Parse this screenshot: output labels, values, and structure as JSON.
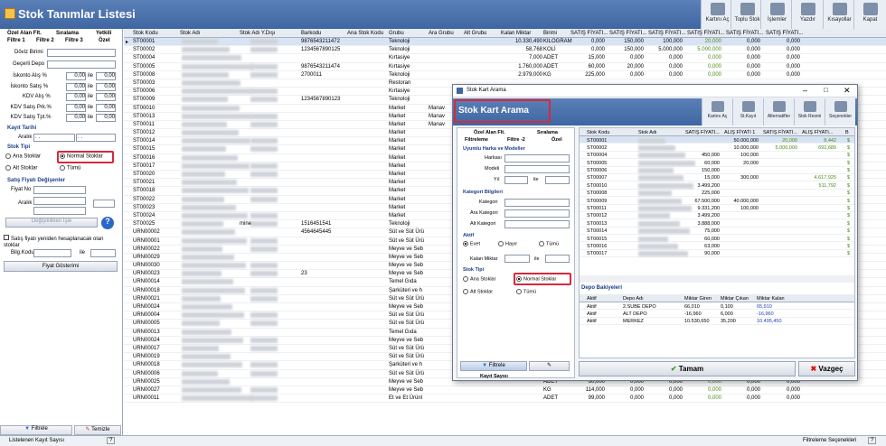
{
  "window": {
    "title": "Stok Tanımlar Listesi"
  },
  "toolbar": [
    {
      "label": "Kartını Aç",
      "icon": "open-card-icon"
    },
    {
      "label": "Toplu Stok",
      "icon": "bulk-stock-icon"
    },
    {
      "label": "İşlemler",
      "icon": "operations-icon"
    },
    {
      "label": "Yazdır",
      "icon": "print-icon"
    },
    {
      "label": "Kısayollar",
      "icon": "shortcuts-icon"
    },
    {
      "label": "Kapat",
      "icon": "close-door-icon"
    }
  ],
  "left": {
    "tabs": [
      "Özel Alan Flt.",
      "Sıralama",
      "Yetkili",
      "Filtre 1",
      "Filtre 2",
      "Filtre 3",
      "Özel"
    ],
    "doviz_label": "Döviz Birimi",
    "depo_label": "Geçerli Depo",
    "discounts": [
      {
        "label": "İskonto Alış %",
        "a": "0,00",
        "ile": "ile",
        "b": "0,00"
      },
      {
        "label": "İskonto Satış %",
        "a": "0,00",
        "ile": "ile",
        "b": "0,00"
      },
      {
        "label": "KDV Alış %",
        "a": "0,00",
        "ile": "ile",
        "b": "0,00"
      },
      {
        "label": "KDV Satış Prk.%",
        "a": "0,00",
        "ile": "ile",
        "b": "0,00"
      },
      {
        "label": "KDV Satış Tpt.%",
        "a": "0,00",
        "ile": "ile",
        "b": "0,00"
      }
    ],
    "kayit_tarihi": "Kayıt Tarihi",
    "aralik": "Aralık",
    "date_a": ". .",
    "date_b": ". .",
    "stok_tipi": "Stok Tipi",
    "ana": "Ana Stoklar",
    "normal": "Normal Stoklar",
    "alt": "Alt Stoklar",
    "tumu": "Tümü",
    "satis_fiyati": "Satış Fiyatı Değişenler",
    "fiyat_no": "Fiyat No",
    "recalc": "Satış fiyatı yeniden hesaplanacak olan stoklar",
    "bilg_kodu": "Bilg.Kodu",
    "ile": "ile",
    "fiyat_goster": "Fiyat Gösterimi",
    "degistir": "Değişiklikleri İşle",
    "filtrele": "Filtrele",
    "temizle": "Temizle"
  },
  "grid": {
    "headers": [
      "Stok Kodu",
      "Stok Adı",
      "Stok Adı Y.Dışı",
      "Barkodu",
      "Ana Stok Kodu",
      "Grubu",
      "Ara Grubu",
      "Alt Grubu",
      "Kalan Miktar",
      "Birimi",
      "SATIŞ FİYATI...",
      "SATIŞ FİYATI...",
      "SATIŞ FİYATI...",
      "SATIŞ FİYATI...",
      "SATIŞ FİYATI...",
      "SATIŞ FİYATI..."
    ],
    "rows": [
      [
        "ST00001",
        "",
        "",
        "9876543211472",
        "",
        "Teknoloji",
        "",
        "",
        "10.330,490",
        "KILOGRAM",
        "0,000",
        "150,000",
        "100,000",
        "20,000",
        "0,000",
        "0,000"
      ],
      [
        "ST00002",
        "",
        "",
        "1234567890125",
        "",
        "Teknoloji",
        "",
        "",
        "58,768",
        "KOLİ",
        "0,000",
        "150,000",
        "5.000,000",
        "5.000,000",
        "0,000",
        "0,000"
      ],
      [
        "ST00004",
        "",
        "",
        "",
        "",
        "Kırtasiye",
        "",
        "",
        "7,000",
        "ADET",
        "15,000",
        "0,000",
        "0,000",
        "0,000",
        "0,000",
        "0,000"
      ],
      [
        "ST00005",
        "",
        "",
        "9876543211474",
        "",
        "Kırtasiye",
        "",
        "",
        "1.760,000",
        "ADET",
        "60,000",
        "20,000",
        "0,000",
        "0,000",
        "0,000",
        "0,000"
      ],
      [
        "ST00008",
        "",
        "",
        "2700011",
        "",
        "Teknoloji",
        "",
        "",
        "2.979,000",
        "KG",
        "225,000",
        "0,000",
        "0,000",
        "0,000",
        "0,000",
        "0,000"
      ],
      [
        "ST00003",
        "",
        "",
        "",
        "",
        "Restoran",
        "",
        "",
        "",
        "",
        "",
        "",
        "",
        "",
        "",
        ""
      ],
      [
        "ST00006",
        "",
        "",
        "",
        "",
        "Kırtasiye",
        "",
        "",
        "",
        "",
        "",
        "",
        "",
        "",
        "",
        ""
      ],
      [
        "ST00009",
        "",
        "",
        "1234567890123",
        "",
        "Teknoloji",
        "",
        "",
        "",
        "",
        "",
        "",
        "",
        "",
        "",
        ""
      ],
      [
        "ST00010",
        "",
        "",
        "",
        "",
        "Market",
        "Manav",
        "",
        "",
        "",
        "",
        "",
        "",
        "",
        "",
        ""
      ],
      [
        "ST00013",
        "",
        "",
        "",
        "",
        "Market",
        "Manav",
        "",
        "",
        "",
        "",
        "",
        "",
        "",
        "",
        ""
      ],
      [
        "ST00011",
        "",
        "",
        "",
        "",
        "Market",
        "Manav",
        "",
        "",
        "",
        "",
        "",
        "",
        "",
        "",
        ""
      ],
      [
        "ST00012",
        "",
        "",
        "",
        "",
        "Market",
        "",
        "",
        "",
        "",
        "",
        "",
        "",
        "",
        "",
        ""
      ],
      [
        "ST00014",
        "",
        "",
        "",
        "",
        "Market",
        "",
        "",
        "",
        "",
        "",
        "",
        "",
        "",
        "",
        ""
      ],
      [
        "ST00015",
        "",
        "",
        "",
        "",
        "Market",
        "",
        "",
        "",
        "",
        "",
        "",
        "",
        "",
        "",
        ""
      ],
      [
        "ST00016",
        "",
        "",
        "",
        "",
        "Market",
        "",
        "",
        "",
        "",
        "",
        "",
        "",
        "",
        "",
        ""
      ],
      [
        "ST00017",
        "",
        "",
        "",
        "",
        "Market",
        "",
        "",
        "",
        "",
        "",
        "",
        "",
        "",
        "",
        ""
      ],
      [
        "ST00020",
        "",
        "",
        "",
        "",
        "Market",
        "",
        "",
        "",
        "",
        "",
        "",
        "",
        "",
        "",
        ""
      ],
      [
        "ST00021",
        "",
        "",
        "",
        "",
        "Market",
        "",
        "",
        "",
        "",
        "",
        "",
        "",
        "",
        "",
        ""
      ],
      [
        "ST00018",
        "",
        "",
        "",
        "",
        "Market",
        "",
        "",
        "",
        "",
        "",
        "",
        "",
        "",
        "",
        ""
      ],
      [
        "ST00022",
        "",
        "",
        "",
        "",
        "Market",
        "",
        "",
        "",
        "",
        "",
        "",
        "",
        "",
        "",
        ""
      ],
      [
        "ST00023",
        "",
        "",
        "",
        "",
        "Market",
        "",
        "",
        "",
        "",
        "",
        "",
        "",
        "",
        "",
        ""
      ],
      [
        "ST00024",
        "",
        "",
        "",
        "",
        "Market",
        "",
        "",
        "",
        "",
        "",
        "",
        "",
        "",
        "",
        ""
      ],
      [
        "ST00025",
        "",
        "mine",
        "1516451541",
        "",
        "Teknoloji",
        "",
        "",
        "",
        "",
        "",
        "",
        "",
        "",
        "",
        ""
      ],
      [
        "URN00002",
        "",
        "",
        "4564645445",
        "",
        "Süt ve Süt Ürü",
        "",
        "",
        "",
        "",
        "",
        "",
        "",
        "",
        "",
        ""
      ],
      [
        "URN00001",
        "",
        "",
        "",
        "",
        "Süt ve Süt Ürü",
        "",
        "",
        "",
        "",
        "",
        "",
        "",
        "",
        "",
        ""
      ],
      [
        "URN00022",
        "",
        "",
        "",
        "",
        "Meyve ve Seb",
        "",
        "",
        "",
        "",
        "",
        "",
        "",
        "",
        "",
        ""
      ],
      [
        "URN00029",
        "",
        "",
        "",
        "",
        "Meyve ve Seb",
        "",
        "",
        "",
        "",
        "",
        "",
        "",
        "",
        "",
        ""
      ],
      [
        "URN00030",
        "",
        "",
        "",
        "",
        "Meyve ve Seb",
        "",
        "",
        "",
        "",
        "",
        "",
        "",
        "",
        "",
        ""
      ],
      [
        "URN00023",
        "",
        "",
        "23",
        "",
        "Meyve ve Seb",
        "",
        "",
        "",
        "",
        "",
        "",
        "",
        "",
        "",
        ""
      ],
      [
        "URN00014",
        "",
        "",
        "",
        "",
        "Temel Gıda",
        "",
        "",
        "",
        "",
        "",
        "",
        "",
        "",
        "",
        ""
      ],
      [
        "URN00018",
        "",
        "",
        "",
        "",
        "Şarküteri ve h",
        "",
        "",
        "",
        "",
        "",
        "",
        "",
        "",
        "",
        ""
      ],
      [
        "URN00021",
        "",
        "",
        "",
        "",
        "Süt ve Süt Ürü",
        "",
        "",
        "",
        "",
        "",
        "",
        "",
        "",
        "",
        ""
      ],
      [
        "URN00024",
        "",
        "",
        "",
        "",
        "Meyve ve Seb",
        "",
        "",
        "",
        "",
        "",
        "",
        "",
        "",
        "",
        ""
      ],
      [
        "URN00004",
        "",
        "",
        "",
        "",
        "Süt ve Süt Ürü",
        "",
        "",
        "",
        "",
        "",
        "",
        "",
        "",
        "",
        ""
      ],
      [
        "URN00005",
        "",
        "",
        "",
        "",
        "Süt ve Süt Ürü",
        "",
        "",
        "",
        "",
        "",
        "",
        "",
        "",
        "",
        ""
      ],
      [
        "URN00013",
        "",
        "",
        "",
        "",
        "Temel Gıda",
        "",
        "",
        "",
        "",
        "",
        "",
        "",
        "",
        "",
        ""
      ],
      [
        "URN00024",
        "",
        "",
        "",
        "",
        "Meyve ve Seb",
        "",
        "",
        "",
        "",
        "",
        "",
        "",
        "",
        "",
        ""
      ],
      [
        "URN00017",
        "",
        "",
        "",
        "",
        "Süt ve Süt Ürü",
        "",
        "",
        "",
        "",
        "",
        "",
        "",
        "",
        "",
        ""
      ],
      [
        "URN00019",
        "",
        "",
        "",
        "",
        "Süt ve Süt Ürü",
        "",
        "",
        "",
        "",
        "",
        "",
        "",
        "",
        "",
        ""
      ],
      [
        "URN00018",
        "",
        "",
        "",
        "",
        "Şarküteri ve h",
        "",
        "",
        "",
        "",
        "",
        "",
        "",
        "",
        "",
        ""
      ],
      [
        "URN00006",
        "",
        "",
        "",
        "",
        "Süt ve Süt Ürü",
        "",
        "",
        "",
        "ADET",
        "78,000",
        "0,000",
        "0,000",
        "0,000",
        "0,000",
        "0,000"
      ],
      [
        "URN00025",
        "",
        "",
        "",
        "",
        "Meyve ve Seb",
        "",
        "",
        "",
        "ADET",
        "60,000",
        "0,000",
        "0,000",
        "0,000",
        "0,000",
        "0,000"
      ],
      [
        "URN00027",
        "",
        "",
        "",
        "",
        "Meyve ve Seb",
        "",
        "",
        "",
        "KG",
        "114,000",
        "0,000",
        "0,000",
        "0,000",
        "0,000",
        "0,000"
      ],
      [
        "URN00011",
        "",
        "",
        "",
        "",
        "Et ve Et Ürünl",
        "",
        "",
        "",
        "ADET",
        "99,000",
        "0,000",
        "0,000",
        "0,000",
        "0,000",
        "0,000"
      ]
    ]
  },
  "status": {
    "left": "Listelenen Kayıt Sayısı",
    "right": "Filtreleme Seçenekleri",
    "q": "?"
  },
  "dialog": {
    "titlebar": "Stok Kart Arama",
    "title": "Stok Kart Arama",
    "toolbar": [
      "Kartını Aç",
      "St.Kayıt",
      "Alternatifler",
      "Stok Resmi",
      "Seçenekler"
    ],
    "tabs": [
      "Özel Alan Flt.",
      "Sıralama",
      "Filtreleme",
      "Filtre -2",
      "Özel"
    ],
    "uyumlu": "Uyumlu Harka ve Modeller",
    "marka": "Harkası",
    "model": "Modeli",
    "yil": "Yıl",
    "ile": "ile",
    "kategori_bilgileri": "Kategori Bilgileri",
    "kategori": "Kategori",
    "ara_kategori": "Ara Kategori",
    "alt_kategori": "Alt Kategori",
    "aktif": "Aktif",
    "evet": "Evet",
    "hayir": "Hayır",
    "tumu": "Tümü",
    "kalan": "Kalan Miktar",
    "stok_tipi": "Stok Tipi",
    "ana": "Ana Stoklar",
    "normal": "Normal Stoklar",
    "alt": "Alt Stoklar",
    "tumu2": "Tümü",
    "filtrele": "Filtrele",
    "kayit_sayisi": "Kayıt Sayısı",
    "headers": [
      "Stok Kodu",
      "Stok Adı",
      "SATIŞ FİYATI...",
      "ALIŞ FİYATI 1",
      "SATIŞ FİYATI...",
      "ALIŞ FİYATI...",
      "B"
    ],
    "rows": [
      [
        "ST00001",
        "",
        "",
        "50.000,000",
        "20,000",
        "8,442",
        ""
      ],
      [
        "ST00002",
        "",
        "",
        "10.000,000",
        "5.000,000",
        "692,689",
        ""
      ],
      [
        "ST00004",
        "",
        "450,000",
        "100,000",
        "",
        "",
        ""
      ],
      [
        "ST00005",
        "",
        "60,000",
        "20,000",
        "",
        "",
        ""
      ],
      [
        "ST00006",
        "",
        "150,000",
        "",
        "",
        "",
        ""
      ],
      [
        "ST00007",
        "",
        "15,000",
        "300,000",
        "",
        "4.617,925",
        ""
      ],
      [
        "ST00010",
        "",
        "3.499,200",
        "",
        "",
        "511,792",
        ""
      ],
      [
        "ST00008",
        "",
        "225,000",
        "",
        "",
        "",
        ""
      ],
      [
        "ST00009",
        "",
        "67.500,000",
        "40.000,000",
        "",
        "",
        ""
      ],
      [
        "ST00011",
        "",
        "9.331,200",
        "100,000",
        "",
        "",
        ""
      ],
      [
        "ST00012",
        "",
        "3.499,200",
        "",
        "",
        "",
        ""
      ],
      [
        "ST00013",
        "",
        "3.888,000",
        "",
        "",
        "",
        ""
      ],
      [
        "ST00014",
        "",
        "75,000",
        "",
        "",
        "",
        ""
      ],
      [
        "ST00015",
        "",
        "60,000",
        "",
        "",
        "",
        ""
      ],
      [
        "ST00016",
        "",
        "63,000",
        "",
        "",
        "",
        ""
      ],
      [
        "ST00017",
        "",
        "90,000",
        "",
        "",
        "",
        ""
      ]
    ],
    "depo_title": "Depo Bakiyeleri",
    "depo_headers": [
      "Aktif",
      "Depo Adı",
      "Miktar Giren",
      "Miktar Çıkan",
      "Miktar Kalan"
    ],
    "depo_rows": [
      [
        "Aktif",
        "2.SUBE DEPO",
        "66,010",
        "0,100",
        "65,910"
      ],
      [
        "Aktif",
        "ALT DEPO",
        "-16,960",
        "6,000",
        "-16,960"
      ],
      [
        "Aktif",
        "MERKEZ",
        "10.530,650",
        "35,200",
        "10.495,450"
      ]
    ],
    "tamam": "Tamam",
    "vazgec": "Vazgeç"
  }
}
